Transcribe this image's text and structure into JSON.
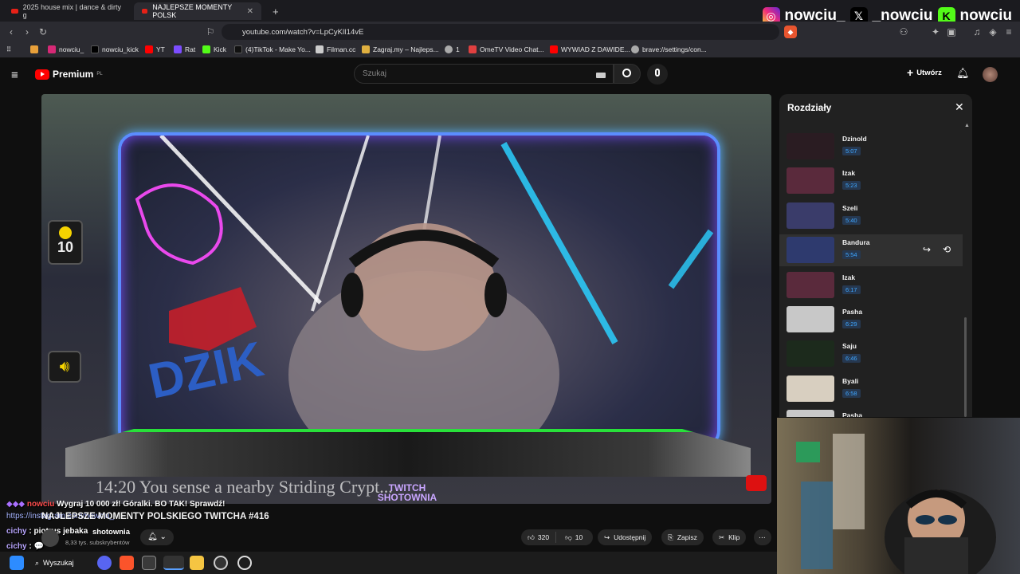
{
  "browser": {
    "tabs": [
      {
        "label": "2025 house mix | dance & dirty g"
      },
      {
        "label": "NAJLEPSZE MOMENTY POLSK",
        "close": "✕"
      }
    ],
    "new_tab": "+",
    "url": "youtube.com/watch?v=LpCyKlI14vE",
    "bookmarks": [
      {
        "label": "nowciu_",
        "color": "#d62976"
      },
      {
        "label": "nowciu_kick",
        "color": "#000000"
      },
      {
        "label": "YT",
        "color": "#ff0000"
      },
      {
        "label": "Rat",
        "color": "#7c4dff"
      },
      {
        "label": "Kick",
        "color": "#53fc18"
      },
      {
        "label": "(4)TikTok - Make Yo...",
        "color": "#111111"
      },
      {
        "label": "Filman.cc",
        "color": "#cccccc"
      },
      {
        "label": "Zagraj.my – Najleps...",
        "color": "#e0b040"
      },
      {
        "label": "1",
        "color": "#aaaaaa"
      },
      {
        "label": "OmeTV Video Chat...",
        "color": "#e04040"
      },
      {
        "label": "WYWIAD Z DAWIDE...",
        "color": "#ff0000"
      },
      {
        "label": "brave://settings/con...",
        "color": "#aaaaaa"
      }
    ]
  },
  "overlay_social": [
    {
      "icon": "instagram-icon",
      "handle": "nowciu_",
      "color": "#d62976"
    },
    {
      "icon": "x-icon",
      "handle": "_nowciu",
      "color": "#000000"
    },
    {
      "icon": "kick-icon",
      "handle": "nowciu",
      "color": "#53fc18"
    }
  ],
  "youtube": {
    "logo": "Premium",
    "logo_region": "PL",
    "search_placeholder": "Szukaj",
    "create_label": "Utwórz",
    "video": {
      "side_counter": "10",
      "subtitle_text": "14:20 You sense a nearby Striding Crypt...",
      "watermark": "TWITCH SHOTOWNIA"
    },
    "chapters": {
      "title": "Rozdziały",
      "items": [
        {
          "name": "Dzinold",
          "time": "5:07",
          "thumb": "#2a1c22"
        },
        {
          "name": "Izak",
          "time": "5:23",
          "thumb": "#5a2a3c"
        },
        {
          "name": "Szeli",
          "time": "5:40",
          "thumb": "#3a3c6a"
        },
        {
          "name": "Bandura",
          "time": "5:54",
          "thumb": "#2e3a6e",
          "active": true
        },
        {
          "name": "Izak",
          "time": "6:17",
          "thumb": "#5a2a3c"
        },
        {
          "name": "Pasha",
          "time": "6:29",
          "thumb": "#c8c8c8"
        },
        {
          "name": "Saju",
          "time": "6:46",
          "thumb": "#1c2a1c"
        },
        {
          "name": "Byali",
          "time": "6:58",
          "thumb": "#d8cfc0"
        },
        {
          "name": "Pasha",
          "time": "",
          "thumb": "#c8c8c8"
        }
      ]
    },
    "channel": {
      "title": "NAJLEPSZE MOMENTY POLSKIEGO TWITCHA #416",
      "name": "shotownia",
      "subs": "8,33 tys. subskrybentów"
    },
    "actions": {
      "likes": "320",
      "dislikes": "10",
      "share": "Udostępnij",
      "save": "Zapisz",
      "clip": "Klip",
      "more": "⋯"
    }
  },
  "chat": [
    {
      "user": "nowciu",
      "text": "Wygraj 10 000 zł! Góralki. BO TAK! Sprawdź!"
    },
    {
      "user": "",
      "text": "https://instagram.com/nowciu_"
    },
    {
      "user": "cichy",
      "text": "piotrus jebaka"
    },
    {
      "user": "cichy",
      "text": "💬"
    }
  ],
  "taskbar": {
    "search": "Wyszukaj"
  }
}
